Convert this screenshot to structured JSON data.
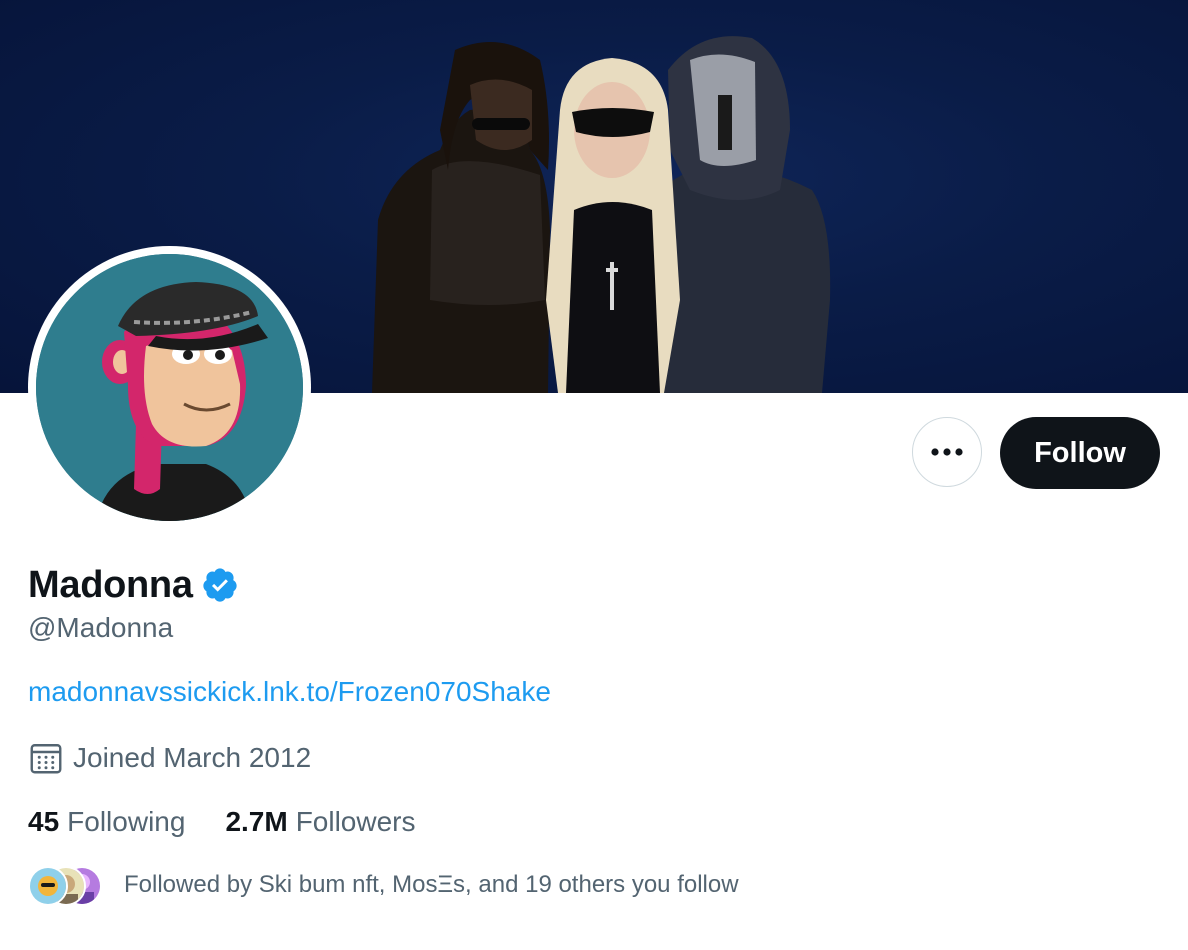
{
  "profile": {
    "display_name": "Madonna",
    "handle": "@Madonna",
    "link": "madonnavssickick.lnk.to/Frozen070Shake",
    "joined": "Joined March 2012",
    "verified": true
  },
  "actions": {
    "more_icon": "more-horizontal-icon",
    "follow_label": "Follow"
  },
  "stats": {
    "following_count": "45",
    "following_label": "Following",
    "followers_count": "2.7M",
    "followers_label": "Followers"
  },
  "followed_by": {
    "text": "Followed by Ski bum nft, MosΞs, and 19 others you follow"
  },
  "colors": {
    "link": "#1d9bf0",
    "verified": "#1d9bf0",
    "follow_button_bg": "#0f1419",
    "secondary_text": "#536471",
    "banner_bg": "#0a1c47"
  }
}
